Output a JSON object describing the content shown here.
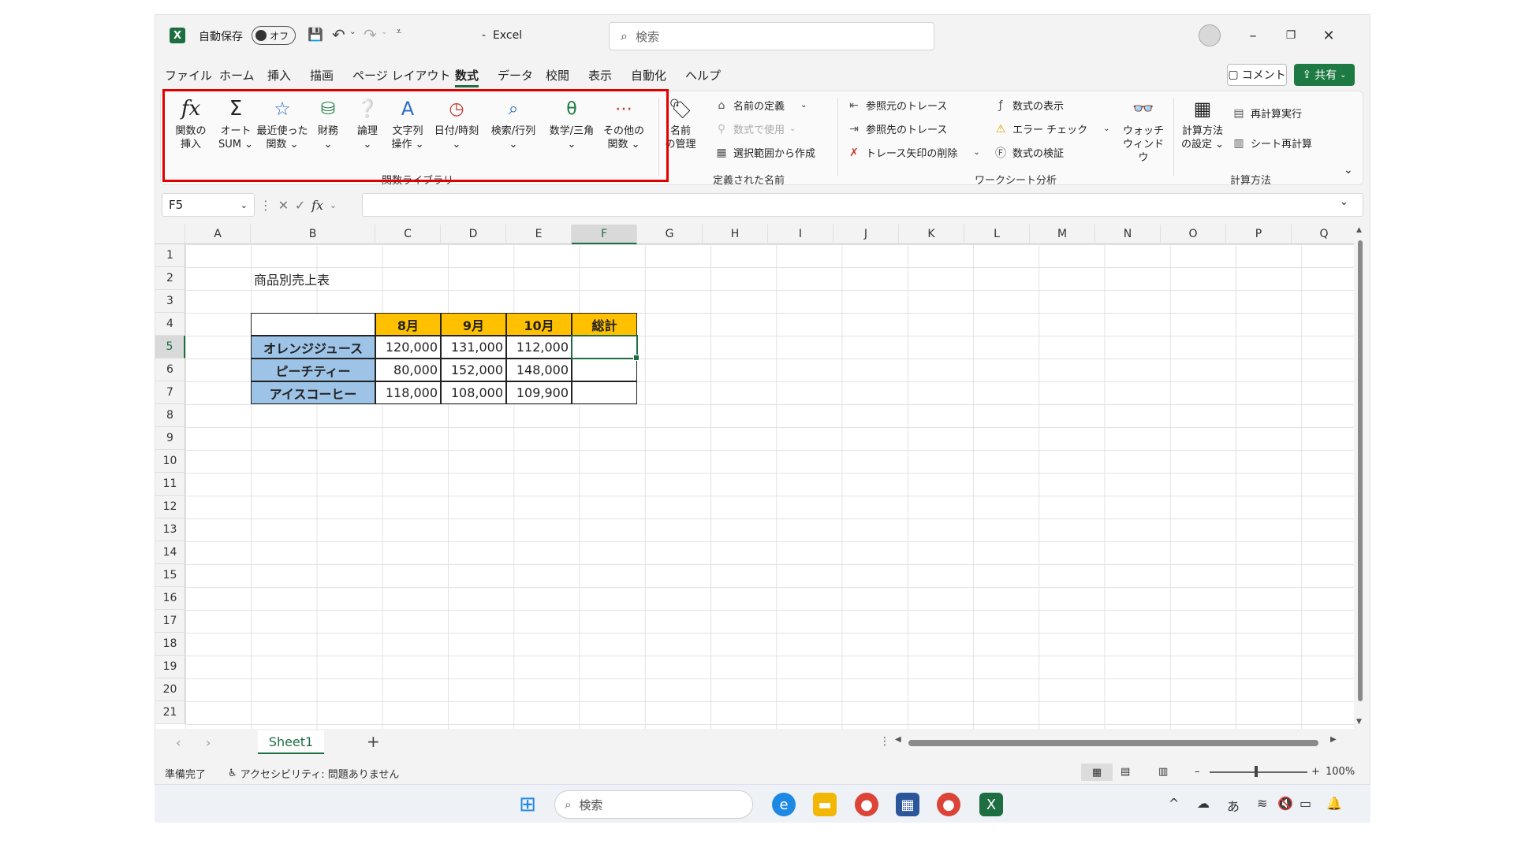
{
  "app": {
    "logo": "X",
    "autosave_label": "自動保存",
    "autosave_state": "オフ",
    "title": "Excel",
    "search_placeholder": "検索"
  },
  "menu": {
    "tabs": [
      "ファイル",
      "ホーム",
      "挿入",
      "描画",
      "ページ レイアウト",
      "数式",
      "データ",
      "校閲",
      "表示",
      "自動化",
      "ヘルプ"
    ],
    "active_tab": "数式",
    "comment_button": "コメント",
    "share_button": "共有"
  },
  "ribbon": {
    "function_library": {
      "group_label": "関数ライブラリ",
      "buttons": [
        {
          "label": "関数の\n挿入",
          "icon": "fx-icon"
        },
        {
          "label": "オート\nSUM ⌄",
          "icon": "sigma-icon"
        },
        {
          "label": "最近使った\n関数 ⌄",
          "icon": "star-icon"
        },
        {
          "label": "財務\n⌄",
          "icon": "finance-icon"
        },
        {
          "label": "論理\n⌄",
          "icon": "question-icon"
        },
        {
          "label": "文字列\n操作 ⌄",
          "icon": "text-a-icon"
        },
        {
          "label": "日付/時刻\n⌄",
          "icon": "clock-icon"
        },
        {
          "label": "検索/行列\n⌄",
          "icon": "lookup-icon"
        },
        {
          "label": "数学/三角\n⌄",
          "icon": "math-icon"
        },
        {
          "label": "その他の\n関数 ⌄",
          "icon": "more-icon"
        }
      ]
    },
    "defined_names": {
      "group_label": "定義された名前",
      "manager": "名前\nの管理",
      "define_name": "名前の定義",
      "use_in_formula": "数式で使用",
      "create_from_selection": "選択範囲から作成"
    },
    "formula_auditing": {
      "group_label": "ワークシート分析",
      "trace_precedents": "参照元のトレース",
      "trace_dependents": "参照先のトレース",
      "remove_arrows": "トレース矢印の削除",
      "show_formulas": "数式の表示",
      "error_checking": "エラー チェック",
      "evaluate_formula": "数式の検証",
      "watch_window": "ウォッチ\nウィンドウ"
    },
    "calculation": {
      "group_label": "計算方法",
      "options": "計算方法\nの設定 ⌄",
      "calc_now": "再計算実行",
      "calc_sheet": "シート再計算"
    }
  },
  "formula_bar": {
    "name_box": "F5",
    "fx_label": "fx",
    "content": ""
  },
  "columns": [
    "A",
    "B",
    "C",
    "D",
    "E",
    "F",
    "G",
    "H",
    "I",
    "J",
    "K",
    "L",
    "M",
    "N",
    "O",
    "P",
    "Q"
  ],
  "rows": [
    "1",
    "2",
    "3",
    "4",
    "5",
    "6",
    "7",
    "8",
    "9",
    "10",
    "11",
    "12",
    "13",
    "14",
    "15",
    "16",
    "17",
    "18",
    "19",
    "20",
    "21"
  ],
  "selected_cell": {
    "column": "F",
    "row": "5"
  },
  "sheet": {
    "title": "商品別売上表",
    "headers": [
      "8月",
      "9月",
      "10月",
      "総計"
    ],
    "rows": [
      {
        "name": "オレンジジュース",
        "values": [
          "120,000",
          "131,000",
          "112,000",
          ""
        ]
      },
      {
        "name": "ピーチティー",
        "values": [
          "80,000",
          "152,000",
          "148,000",
          ""
        ]
      },
      {
        "name": "アイスコーヒー",
        "values": [
          "118,000",
          "108,000",
          "109,900",
          ""
        ]
      }
    ]
  },
  "sheet_tabs": {
    "active": "Sheet1",
    "add": "+"
  },
  "status": {
    "ready": "準備完了",
    "accessibility": "アクセシビリティ: 問題ありません",
    "zoom": "100%"
  },
  "taskbar": {
    "search_placeholder": "検索",
    "ime": "あ"
  },
  "colors": {
    "excel_green": "#1d6f42",
    "header_fill": "#ffc000",
    "rowlabel_fill": "#9dc3e6",
    "highlight_box": "#e00000"
  }
}
